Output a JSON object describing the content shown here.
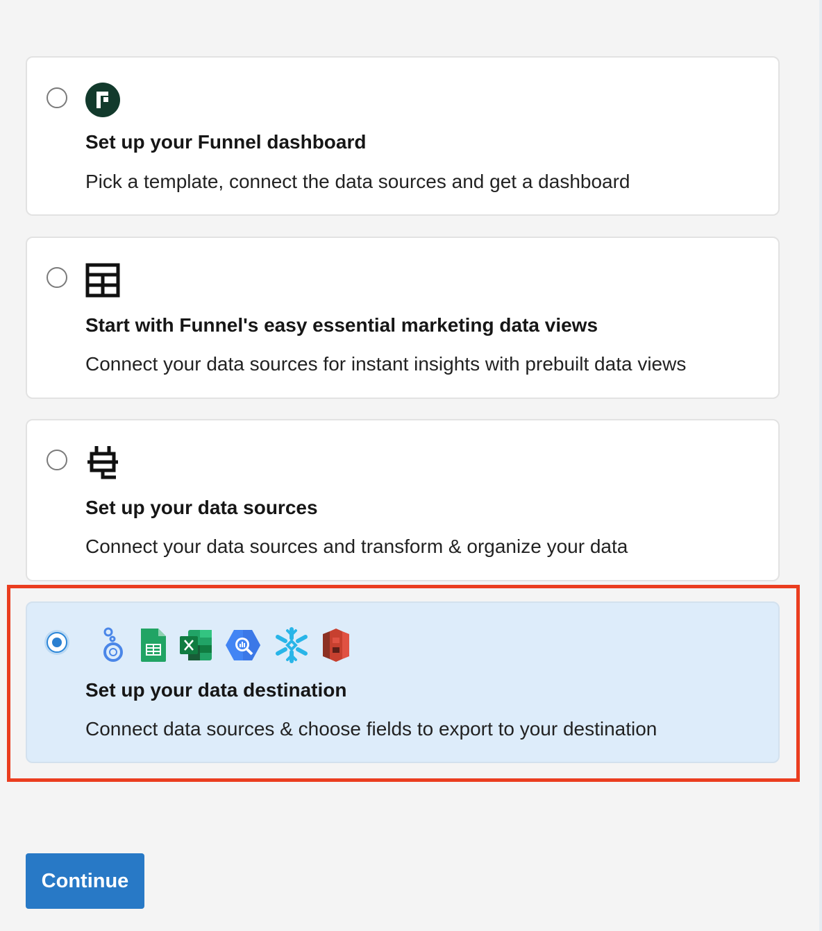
{
  "options": [
    {
      "id": "dashboard",
      "icon": "funnel-logo-icon",
      "title": "Set up your Funnel dashboard",
      "description": "Pick a template, connect the data sources and get a dashboard",
      "selected": false
    },
    {
      "id": "data-views",
      "icon": "table-grid-icon",
      "title": "Start with Funnel's easy essential marketing data views",
      "description": "Connect your data sources for instant insights with prebuilt data views",
      "selected": false
    },
    {
      "id": "data-sources",
      "icon": "plug-icon",
      "title": "Set up your data sources",
      "description": "Connect your data sources and transform & organize your data",
      "selected": false
    },
    {
      "id": "data-destination",
      "icons": [
        "looker-studio-icon",
        "google-sheets-icon",
        "excel-icon",
        "bigquery-icon",
        "snowflake-icon",
        "amazon-s3-icon"
      ],
      "title": "Set up your data destination",
      "description": "Connect data sources & choose fields to export to your destination",
      "selected": true
    }
  ],
  "continue_label": "Continue",
  "colors": {
    "accent": "#2879c6",
    "selected_card": "#ddecfa",
    "highlight": "#ea3d1f",
    "funnel_brand": "#123a2c"
  }
}
